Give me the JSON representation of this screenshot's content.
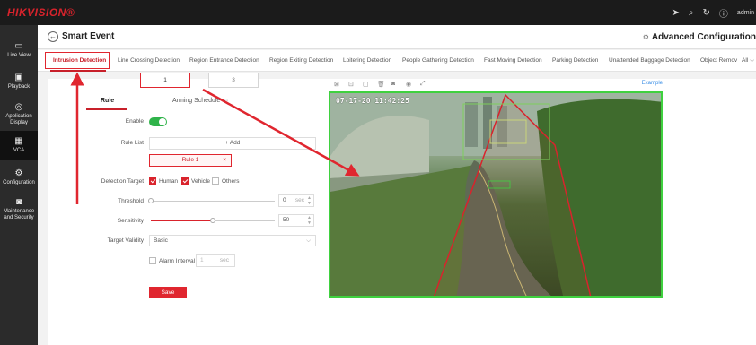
{
  "header": {
    "logo": "HIKVISION®",
    "user": "admin",
    "icons": [
      "send-icon",
      "search-icon",
      "refresh-icon",
      "info-icon"
    ]
  },
  "sidebar": {
    "items": [
      {
        "label": "Live View",
        "icon": "monitor-icon"
      },
      {
        "label": "Playback",
        "icon": "play-icon"
      },
      {
        "label": "Application Display",
        "icon": "app-icon"
      },
      {
        "label": "VCA",
        "icon": "grid-icon"
      },
      {
        "label": "Configuration",
        "icon": "gear-icon"
      },
      {
        "label": "Maintenance and Security",
        "icon": "shield-icon"
      }
    ]
  },
  "page": {
    "title": "Smart Event",
    "advanced": "Advanced Configuration"
  },
  "tabs": [
    "Intrusion Detection",
    "Line Crossing Detection",
    "Region Entrance Detection",
    "Region Exiting Detection",
    "Loitering Detection",
    "People Gathering Detection",
    "Fast Moving Detection",
    "Parking Detection",
    "Unattended Baggage Detection",
    "Object Remov"
  ],
  "tabs_all": "All",
  "rule_tabs": [
    "1",
    "3"
  ],
  "subtabs": {
    "rule": "Rule",
    "arming": "Arming Schedule",
    "arming_more": "···"
  },
  "form": {
    "enable_label": "Enable",
    "rule_list_label": "Rule List",
    "add_label": "+  Add",
    "rule_item": "Rule 1",
    "rule_item_close": "×",
    "target_label": "Detection Target",
    "human": "Human",
    "vehicle": "Vehicle",
    "others": "Others",
    "threshold_label": "Threshold",
    "threshold_value": "0",
    "threshold_unit": "sec",
    "sensitivity_label": "Sensitivity",
    "sensitivity_value": "50",
    "validity_label": "Target Validity",
    "validity_value": "Basic",
    "alarm_interval_label": "Alarm Interval",
    "alarm_interval_value": "1",
    "alarm_interval_unit": "sec",
    "save": "Save"
  },
  "values": {
    "enabled": true,
    "human_checked": true,
    "vehicle_checked": true,
    "others_checked": false,
    "alarm_interval_checked": false,
    "sensitivity_fraction": 0.5,
    "threshold_fraction": 0.0
  },
  "video": {
    "example_link": "Example",
    "osd_time": "07-17-20   11:42:25"
  },
  "colors": {
    "accent": "#d9232c",
    "toggle": "#2fb34a",
    "region": "#3fd13f"
  }
}
